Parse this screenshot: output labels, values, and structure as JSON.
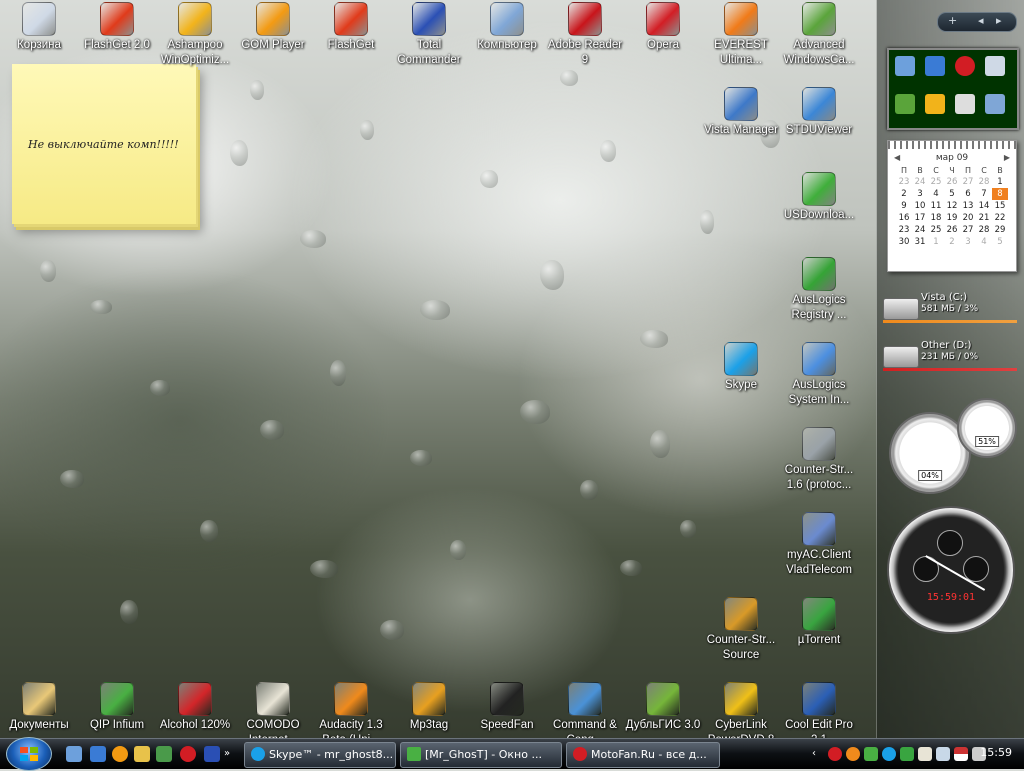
{
  "desktop": {
    "icons": [
      {
        "label": "Корзина",
        "icon": "recycle-bin-icon",
        "color": "#cfd9e6"
      },
      {
        "label": "FlashGet 2.0",
        "icon": "flashget-icon",
        "color": "#e03a1a"
      },
      {
        "label": "Ashampoo WinOptimiz...",
        "icon": "ashampoo-icon",
        "color": "#f2b31a"
      },
      {
        "label": "GOM Player",
        "icon": "gom-player-icon",
        "color": "#f39a12"
      },
      {
        "label": "FlashGet",
        "icon": "flashget-icon",
        "color": "#e03a1a"
      },
      {
        "label": "Total Commander",
        "icon": "floppy-disk-icon",
        "color": "#2a4fb4"
      },
      {
        "label": "Компьютер",
        "icon": "computer-icon",
        "color": "#7fa6d6"
      },
      {
        "label": "Adobe Reader 9",
        "icon": "adobe-reader-icon",
        "color": "#c8141a"
      },
      {
        "label": "Opera",
        "icon": "opera-icon",
        "color": "#d21d24"
      },
      {
        "label": "EVEREST Ultima...",
        "icon": "everest-icon",
        "color": "#f07a18"
      },
      {
        "label": "Advanced WindowsCa...",
        "icon": "advanced-windowscare-icon",
        "color": "#5aa43a"
      },
      {
        "label": "Vista Manager",
        "icon": "vista-manager-icon",
        "color": "#3d78c8"
      },
      {
        "label": "STDUViewer",
        "icon": "stduviewer-icon",
        "color": "#3b86d6"
      },
      {
        "label": "USDownloa...",
        "icon": "usdownloader-icon",
        "color": "#3fae3a"
      },
      {
        "label": "AusLogics Registry ...",
        "icon": "auslogics-registry-icon",
        "color": "#34a335"
      },
      {
        "label": "Skype",
        "icon": "skype-icon",
        "color": "#1aa0e8"
      },
      {
        "label": "AusLogics System In...",
        "icon": "auslogics-system-icon",
        "color": "#4c8fe0"
      },
      {
        "label": "Counter-Str... 1.6 (protoc...",
        "icon": "counter-strike-icon",
        "color": "#9aa2a8"
      },
      {
        "label": "myAC.Client VladTelecom",
        "icon": "myac-client-icon",
        "color": "#6b8bd0"
      },
      {
        "label": "Counter-Str... Source",
        "icon": "counter-strike-source-icon",
        "color": "#d99a28"
      },
      {
        "label": "µTorrent",
        "icon": "utorrent-icon",
        "color": "#39a540"
      },
      {
        "label": "Документы",
        "icon": "folder-icon",
        "color": "#e9c878"
      },
      {
        "label": "QIP Infium",
        "icon": "qip-infium-icon",
        "color": "#49b043"
      },
      {
        "label": "Alcohol 120%",
        "icon": "alcohol-120-icon",
        "color": "#d4262a"
      },
      {
        "label": "COMODO Internet...",
        "icon": "comodo-icon",
        "color": "#e8e4d6"
      },
      {
        "label": "Audacity 1.3 Beta (Uni...",
        "icon": "audacity-icon",
        "color": "#f08a1c"
      },
      {
        "label": "Mp3tag",
        "icon": "mp3tag-icon",
        "color": "#e8a020"
      },
      {
        "label": "SpeedFan",
        "icon": "speedfan-icon",
        "color": "#222222"
      },
      {
        "label": "Command & Conq...",
        "icon": "command-conquer-icon",
        "color": "#4a92d8"
      },
      {
        "label": "ДубльГИС 3.0",
        "icon": "dublgis-icon",
        "color": "#76b63a"
      },
      {
        "label": "CyberLink PowerDVD 8",
        "icon": "powerdvd-icon",
        "color": "#f0c018"
      },
      {
        "label": "Cool Edit Pro 2.1",
        "icon": "cool-edit-icon",
        "color": "#2b5fb6"
      }
    ],
    "sticky_note": "Не выключайте комп!!!!!"
  },
  "sidebar": {
    "calendar": {
      "month": "мар 09",
      "weekdays": [
        "П",
        "В",
        "С",
        "Ч",
        "П",
        "С",
        "В"
      ],
      "rows": [
        [
          "23",
          "24",
          "25",
          "26",
          "27",
          "28",
          "1"
        ],
        [
          "2",
          "3",
          "4",
          "5",
          "6",
          "7",
          "8"
        ],
        [
          "9",
          "10",
          "11",
          "12",
          "13",
          "14",
          "15"
        ],
        [
          "16",
          "17",
          "18",
          "19",
          "20",
          "21",
          "22"
        ],
        [
          "23",
          "24",
          "25",
          "26",
          "27",
          "28",
          "29"
        ],
        [
          "30",
          "31",
          "1",
          "2",
          "3",
          "4",
          "5"
        ]
      ],
      "today": "8"
    },
    "drives": [
      {
        "name": "Vista (C:)",
        "info": "581 МБ / 3%",
        "color": "#f08a1c"
      },
      {
        "name": "Other (D:)",
        "info": "231 МБ / 0%",
        "color": "#d02020"
      }
    ],
    "meters": {
      "cpu": "04%",
      "memory": "51%"
    },
    "clock": {
      "time": "15:59:01"
    }
  },
  "taskbar": {
    "tasks": [
      {
        "label": "Skype™ - mr_ghost8...",
        "icon": "skype-icon",
        "color": "#1aa0e8"
      },
      {
        "label": "[Mr_GhosT] - Окно ...",
        "icon": "qip-chat-icon",
        "color": "#49b043"
      },
      {
        "label": "MotoFan.Ru - все д...",
        "icon": "opera-icon",
        "color": "#d21d24"
      }
    ],
    "clock": "15:59"
  }
}
